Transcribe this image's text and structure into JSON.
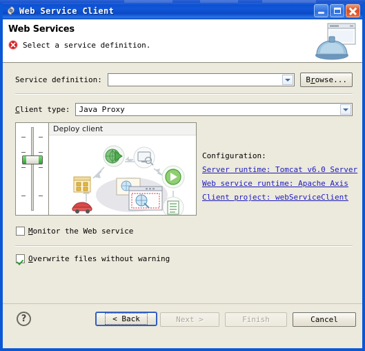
{
  "window": {
    "title": "Web Service Client",
    "title_icon": "gear-icon",
    "controls": {
      "minimize": "Minimize",
      "maximize": "Maximize",
      "close": "Close"
    }
  },
  "header": {
    "title": "Web Services",
    "status_icon": "error-icon",
    "message": "Select a service definition.",
    "banner_icon": "web-service-server-icon"
  },
  "form": {
    "service_definition": {
      "label": "Service definition:",
      "value": "",
      "placeholder": "",
      "dropdown_icon": "chevron-down-icon"
    },
    "browse_button": {
      "prefix": "B",
      "mnemonic": "r",
      "suffix": "owse..."
    },
    "client_type": {
      "label_prefix": "",
      "label_mnemonic": "C",
      "label_suffix": "lient type:",
      "value": "Java Proxy",
      "dropdown_icon": "chevron-down-icon"
    }
  },
  "graphic": {
    "slider": {
      "name": "deployment-stage-slider",
      "value": 1,
      "min": 0,
      "max": 3,
      "ticks": 4
    },
    "panel_title": "Deploy client",
    "diagram_icons": [
      "globe-play-icon",
      "monitor-search-icon",
      "green-play-icon",
      "list-document-icon",
      "package-icon",
      "car-icon",
      "browser-globe-icon"
    ]
  },
  "configuration": {
    "title": "Configuration:",
    "links": [
      {
        "name": "server-runtime-link",
        "text": "Server runtime: Tomcat v6.0 Server"
      },
      {
        "name": "web-service-runtime-link",
        "text": "Web service runtime: Apache Axis"
      },
      {
        "name": "client-project-link",
        "text": "Client project: webServiceClient"
      }
    ]
  },
  "options": {
    "monitor": {
      "checked": false,
      "prefix": "",
      "mnemonic": "M",
      "suffix": "onitor the Web service"
    },
    "overwrite": {
      "checked": true,
      "prefix": "",
      "mnemonic": "O",
      "suffix": "verwrite files without warning"
    }
  },
  "footer": {
    "help_label": "?",
    "buttons": [
      {
        "name": "back-button",
        "label": "< Back",
        "enabled": true,
        "default": true
      },
      {
        "name": "next-button",
        "label": "Next >",
        "enabled": false,
        "default": false
      },
      {
        "name": "finish-button",
        "label": "Finish",
        "enabled": false,
        "default": false
      },
      {
        "name": "cancel-button",
        "label": "Cancel",
        "enabled": true,
        "default": false
      }
    ]
  },
  "colors": {
    "titlebar": "#0d4fd2",
    "window_border": "#0a58d6",
    "dialog_bg": "#ece9dd",
    "link": "#1b1bbf",
    "error": "#cc2222",
    "check": "#2e9c2e"
  }
}
